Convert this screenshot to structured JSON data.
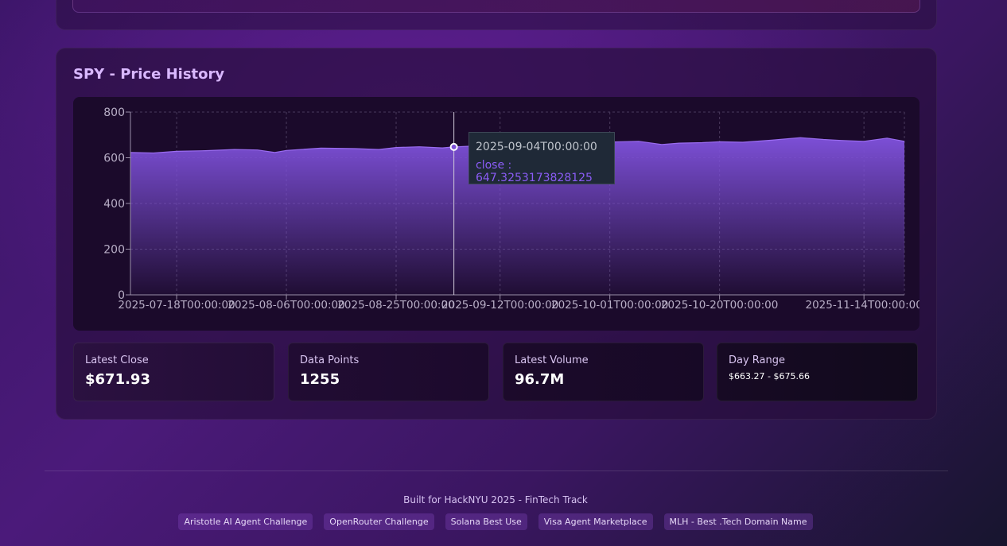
{
  "chart_card": {
    "title": "SPY - Price History"
  },
  "chart_data": {
    "type": "area",
    "x_start": "2025-07-10",
    "x_end": "2025-11-21",
    "x_ticks": [
      "2025-07-18T00:00:00",
      "2025-08-06T00:00:00",
      "2025-08-25T00:00:00",
      "2025-09-12T00:00:00",
      "2025-10-01T00:00:00",
      "2025-10-20T00:00:00",
      "2025-11-14T00:00:00"
    ],
    "y_ticks": [
      0,
      200,
      400,
      600,
      800
    ],
    "ylim": [
      0,
      800
    ],
    "grid": true,
    "series": [
      {
        "dates": [
          "2025-07-10",
          "2025-07-14",
          "2025-07-18",
          "2025-07-23",
          "2025-07-28",
          "2025-08-01",
          "2025-08-04",
          "2025-08-06",
          "2025-08-12",
          "2025-08-18",
          "2025-08-22",
          "2025-08-25",
          "2025-08-29",
          "2025-09-02",
          "2025-09-04",
          "2025-09-08",
          "2025-09-12",
          "2025-09-16",
          "2025-09-22",
          "2025-09-26",
          "2025-10-01",
          "2025-10-06",
          "2025-10-10",
          "2025-10-13",
          "2025-10-17",
          "2025-10-20",
          "2025-10-24",
          "2025-10-29",
          "2025-11-03",
          "2025-11-07",
          "2025-11-10",
          "2025-11-14",
          "2025-11-18",
          "2025-11-21"
        ],
        "values": [
          623,
          621,
          628,
          631,
          636,
          634,
          623,
          632,
          642,
          640,
          636,
          645,
          648,
          643,
          647.3253173828125,
          652,
          660,
          665,
          668,
          672,
          669,
          672,
          658,
          664,
          666,
          670,
          668,
          677,
          688,
          680,
          676,
          672,
          686,
          672
        ]
      }
    ],
    "tooltip": {
      "date": "2025-09-04T00:00:00",
      "text": "close : 647.3253173828125",
      "value": 647.3253173828125
    },
    "colors": {
      "area_top": "#7c4fd6",
      "line": "#9a6cf0",
      "grid": "#4a3a5c",
      "axis": "#9a8fa8",
      "tick_text": "#b8aec6"
    }
  },
  "stats": [
    {
      "label": "Latest Close",
      "value": "$671.93"
    },
    {
      "label": "Data Points",
      "value": "1255"
    },
    {
      "label": "Latest Volume",
      "value": "96.7M"
    },
    {
      "label": "Day Range",
      "value": "$663.27 - $675.66"
    }
  ],
  "footer": {
    "text": "Built for HackNYU 2025 - FinTech Track",
    "badges": [
      "Aristotle AI Agent Challenge",
      "OpenRouter Challenge",
      "Solana Best Use",
      "Visa Agent Marketplace",
      "MLH - Best .Tech Domain Name"
    ]
  }
}
